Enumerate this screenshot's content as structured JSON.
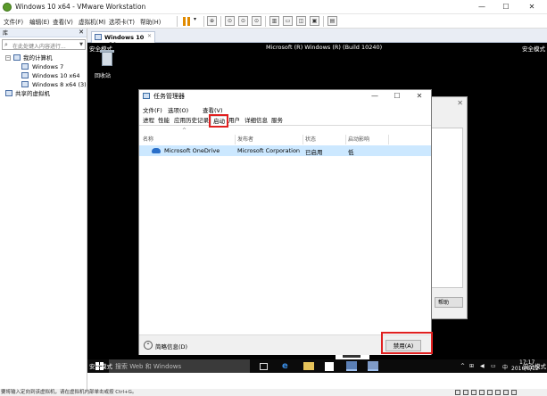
{
  "window": {
    "title": "Windows 10 x64 - VMware Workstation",
    "minimize_glyph": "—",
    "maximize_glyph": "☐",
    "close_glyph": "✕"
  },
  "menu": {
    "file": "文件(F)",
    "edit": "编辑(E)",
    "view": "查看(V)",
    "vm": "虚拟机(M)",
    "tabs": "选项卡(T)",
    "help": "帮助(H)"
  },
  "library": {
    "header": "库",
    "close": "✕",
    "search_placeholder": "在此处键入内容进行...",
    "tree": {
      "my_computer": "我的计算机",
      "vm1": "Windows 7",
      "vm2": "Windows 10 x64",
      "vm3": "Windows 8 x64 (3)",
      "shared": "共享的虚拟机"
    }
  },
  "tab": {
    "label": "Windows 10 x64",
    "close": "✕"
  },
  "vm_screen": {
    "safe_mode": "安全模式",
    "build": "Microsoft (R) Windows (R) (Build 10240)",
    "recycle_bin": "回收站"
  },
  "bg_window": {
    "help": "帮助",
    "close": "✕"
  },
  "task_manager": {
    "title": "任务管理器",
    "menu": {
      "file": "文件(F)",
      "options": "选项(O)",
      "view": "查看(V)"
    },
    "tabs": [
      "进程",
      "性能",
      "应用历史记录",
      "启动",
      "用户",
      "详细信息",
      "服务"
    ],
    "columns": {
      "name": "名称",
      "publisher": "发布者",
      "status": "状态",
      "impact": "启动影响"
    },
    "rows": [
      {
        "name": "Microsoft OneDrive",
        "publisher": "Microsoft Corporation",
        "status": "已启用",
        "impact": "低"
      }
    ],
    "fewer_details": "简略信息(D)",
    "disable_button": "禁用(A)"
  },
  "taskbar": {
    "search_placeholder": "搜索 Web 和 Windows",
    "time": "17:17",
    "date": "2016/8/12",
    "ime": "中"
  },
  "statusbar": {
    "message": "要将输入定向到该虚拟机，请在虚拟机内部单击或按 Ctrl+G。"
  },
  "colors": {
    "accent": "#0078d7",
    "highlight": "#e02020",
    "selection": "#cce8ff"
  }
}
